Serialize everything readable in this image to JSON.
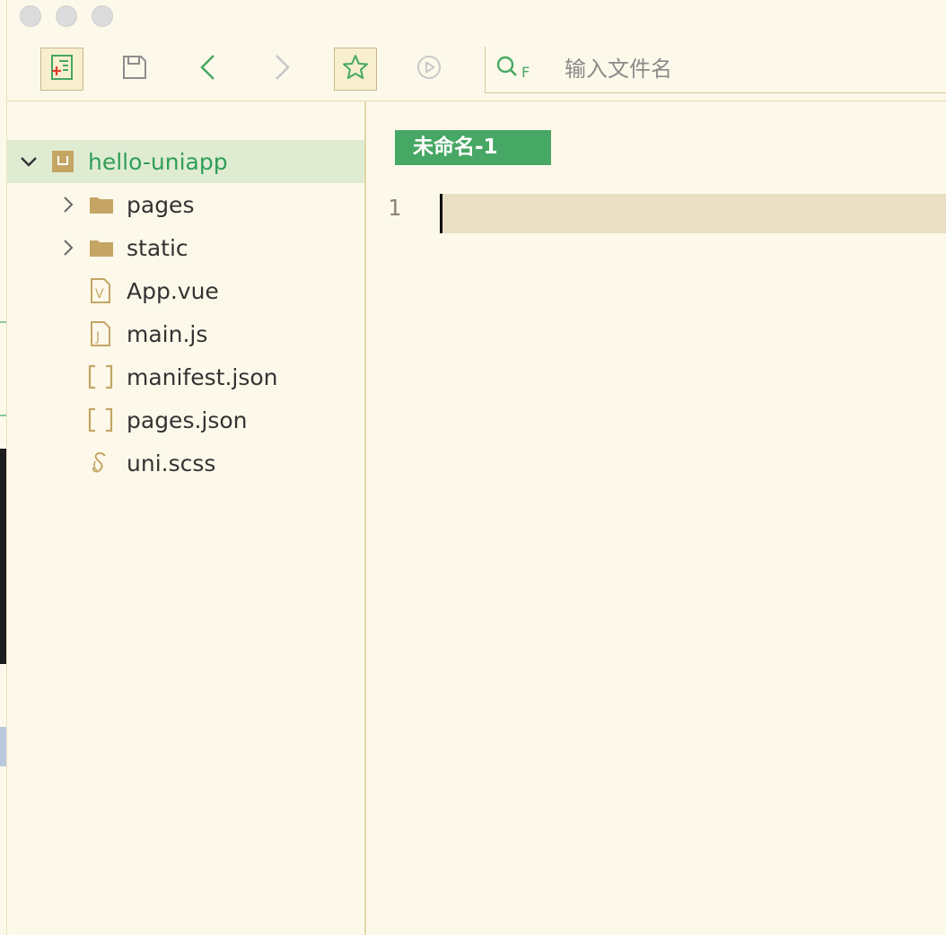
{
  "search": {
    "placeholder": "输入文件名"
  },
  "tree": {
    "project": {
      "name": "hello-uniapp",
      "icon": "project-icon"
    },
    "items": [
      {
        "name": "pages",
        "type": "folder",
        "icon": "folder-icon"
      },
      {
        "name": "static",
        "type": "folder",
        "icon": "folder-icon"
      },
      {
        "name": "App.vue",
        "type": "file",
        "icon": "vue-file-icon"
      },
      {
        "name": "main.js",
        "type": "file",
        "icon": "js-file-icon"
      },
      {
        "name": "manifest.json",
        "type": "file",
        "icon": "json-file-icon"
      },
      {
        "name": "pages.json",
        "type": "file",
        "icon": "json-file-icon"
      },
      {
        "name": "uni.scss",
        "type": "file",
        "icon": "scss-file-icon"
      }
    ]
  },
  "editor": {
    "tab_title": "未命名-1",
    "line_number": "1"
  },
  "colors": {
    "accent": "#47a764",
    "background": "#fdf9ea",
    "icon_gold": "#c4a564",
    "selected_row": "#e0ecd2"
  }
}
